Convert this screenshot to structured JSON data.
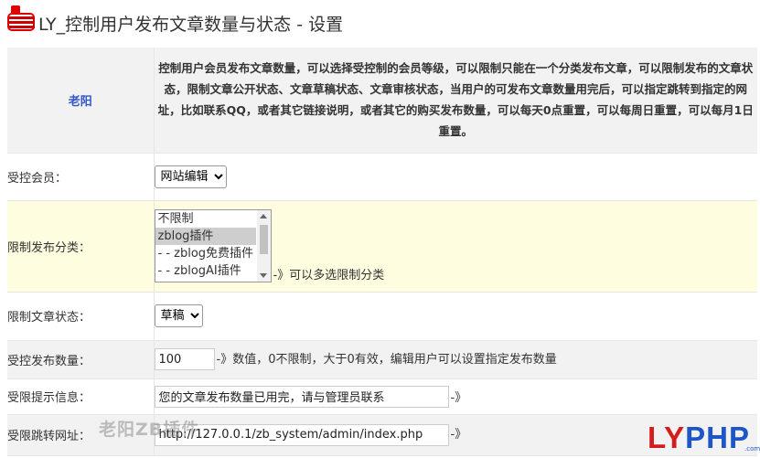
{
  "header": {
    "title": "LY_控制用户发布文章数量与状态 - 设置",
    "icon": "menu-icon"
  },
  "intro": {
    "author": "老阳",
    "description": "控制用户会员发布文章数量，可以选择受控制的会员等级，可以限制只能在一个分类发布文章，可以限制发布的文章状态，限制文章公开状态、文章草稿状态、文章审核状态，当用户的可发布文章数量用完后，可以指定跳转到指定的网址，比如联系QQ，或者其它链接说明，或者其它的购买发布数量，可以每天0点重置，可以每周日重置，可以每月1日重置。"
  },
  "rows": {
    "member": {
      "label": "受控会员：",
      "selected": "网站编辑"
    },
    "category": {
      "label": "限制发布分类：",
      "options": [
        "不限制",
        "zblog插件",
        "- - zblog免费插件",
        "- - zblogAI插件"
      ],
      "selected": "zblog插件",
      "hint": "-》可以多选限制分类"
    },
    "status": {
      "label": "限制文章状态：",
      "selected": "草稿"
    },
    "count": {
      "label": "受控发布数量：",
      "value": "100",
      "hint": "-》数值，0不限制，大于0有效，编辑用户可以设置指定发布数量"
    },
    "message": {
      "label": "受限提示信息：",
      "value": "您的文章发布数量已用完，请与管理员联系",
      "hint": "-》"
    },
    "redirect": {
      "label": "受限跳转网址：",
      "value": "http://127.0.0.1/zb_system/admin/index.php",
      "hint": "-》"
    }
  },
  "watermark": {
    "left_text": "老阳ZB插件",
    "logo_red": "LY",
    "logo_blue": "PHP",
    "logo_sub": ".com"
  },
  "colors": {
    "author": "#3355cc",
    "logo_red": "#d41c1c",
    "logo_blue": "#1e56c8",
    "yellow_row": "#fffde0",
    "gray_row": "#f2f2f2"
  }
}
